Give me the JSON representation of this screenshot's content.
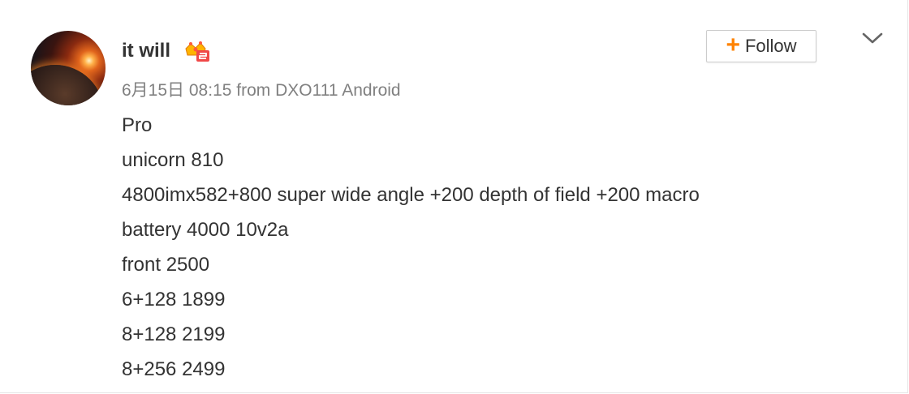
{
  "post": {
    "author": "it will",
    "badge_icon": "crown-vip-badge-icon",
    "date": "6月15日 08:15",
    "from_label": "from",
    "device": "DXO111 Android",
    "lines": [
      "Pro",
      "unicorn 810",
      "4800imx582+800 super wide angle +200 depth of field +200 macro",
      "battery 4000 10v2a",
      "front 2500",
      "6+128 1899",
      "8+128 2199",
      "8+256 2499"
    ]
  },
  "actions": {
    "follow_icon": "plus-icon",
    "follow_label": "Follow",
    "more_icon": "chevron-down-icon"
  },
  "colors": {
    "accent": "#ff8200",
    "text": "#333333",
    "meta": "#808080"
  }
}
